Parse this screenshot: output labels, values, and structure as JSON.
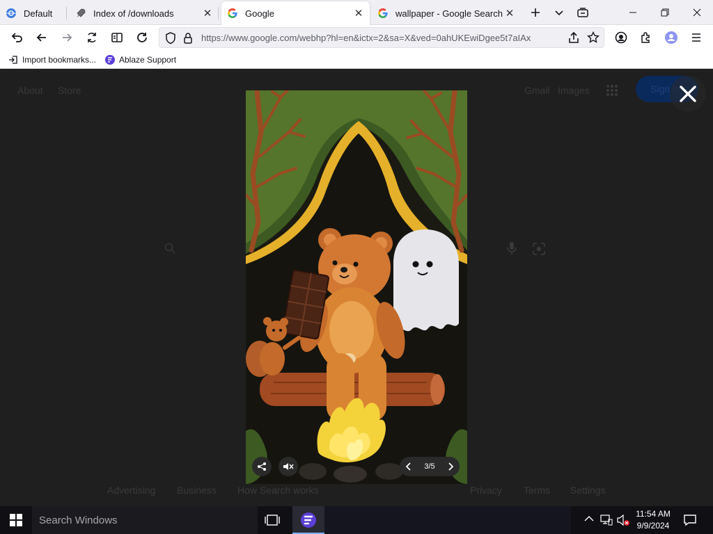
{
  "tabs": [
    {
      "label": "Default",
      "icon": "app-globe-icon",
      "closable": false,
      "active": false
    },
    {
      "label": "Index of /downloads",
      "icon": "rocket-icon",
      "closable": true,
      "active": false
    },
    {
      "label": "Google",
      "icon": "google-g-icon",
      "closable": true,
      "active": true
    },
    {
      "label": "wallpaper - Google Search",
      "icon": "google-g-icon",
      "closable": true,
      "active": false
    }
  ],
  "toolbar": {
    "url": "https://www.google.com/webhp?hl=en&ictx=2&sa=X&ved=0ahUKEwiDgee5t7aIAx",
    "icons": [
      "undo-icon",
      "back-icon",
      "forward-icon",
      "sync-icon",
      "reader-icon",
      "reload-icon",
      "shield-icon",
      "lock-icon",
      "share-icon",
      "star-icon",
      "account-icon",
      "extensions-icon",
      "profile-icon",
      "menu-icon"
    ]
  },
  "bookmarks": [
    {
      "label": "Import bookmarks...",
      "icon": "import-icon"
    },
    {
      "label": "Ablaze Support",
      "icon": "ablaze-logo-icon"
    }
  ],
  "google": {
    "left_links": [
      "About",
      "Store"
    ],
    "right_links": [
      "Gmail",
      "Images"
    ],
    "signin_label": "Sign in",
    "footer_left": [
      "Advertising",
      "Business",
      "How Search works"
    ],
    "footer_right": [
      "Privacy",
      "Terms",
      "Settings"
    ]
  },
  "doodle": {
    "counter": "3/5"
  },
  "taskbar": {
    "search_placeholder": "Search Windows",
    "time": "11:54 AM",
    "date": "9/9/2024"
  },
  "colors": {
    "google_blue": "#1a73e8",
    "tab_bg": "#f0f0f4",
    "taskbar": "#101014",
    "overlay": "#1f1f1f"
  }
}
